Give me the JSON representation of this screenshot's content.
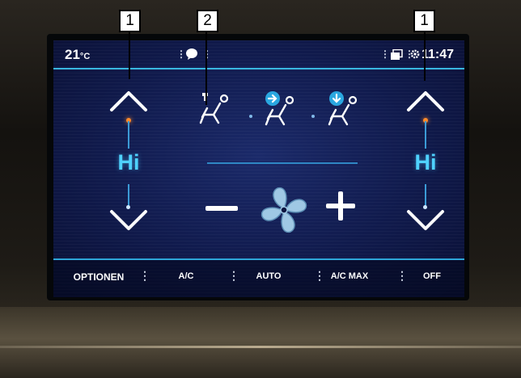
{
  "status_bar": {
    "temperature": "21",
    "temperature_unit": "°C",
    "time": "11:47",
    "icons": [
      "notification-bubble-icon",
      "window-icon",
      "settings-icon"
    ]
  },
  "zones": {
    "left": {
      "value": "Hi"
    },
    "right": {
      "value": "Hi"
    }
  },
  "airflow_modes": [
    "air-to-face-icon",
    "air-to-feet-and-face-icon",
    "air-to-feet-icon"
  ],
  "fan": {
    "icon": "fan-icon",
    "decrease_icon": "minus-icon",
    "increase_icon": "plus-icon"
  },
  "bottom_bar": {
    "options": "OPTIONEN",
    "ac": "A/C",
    "auto": "AUTO",
    "ac_max": "A/C MAX",
    "off": "OFF"
  },
  "callouts": {
    "left": "1",
    "middle": "2",
    "right": "1"
  },
  "colors": {
    "accent": "#39b7e0",
    "temperature_text": "#4fd2ff",
    "indicator_dot": "#ff8a2a",
    "screen_background": "#101a4c"
  }
}
